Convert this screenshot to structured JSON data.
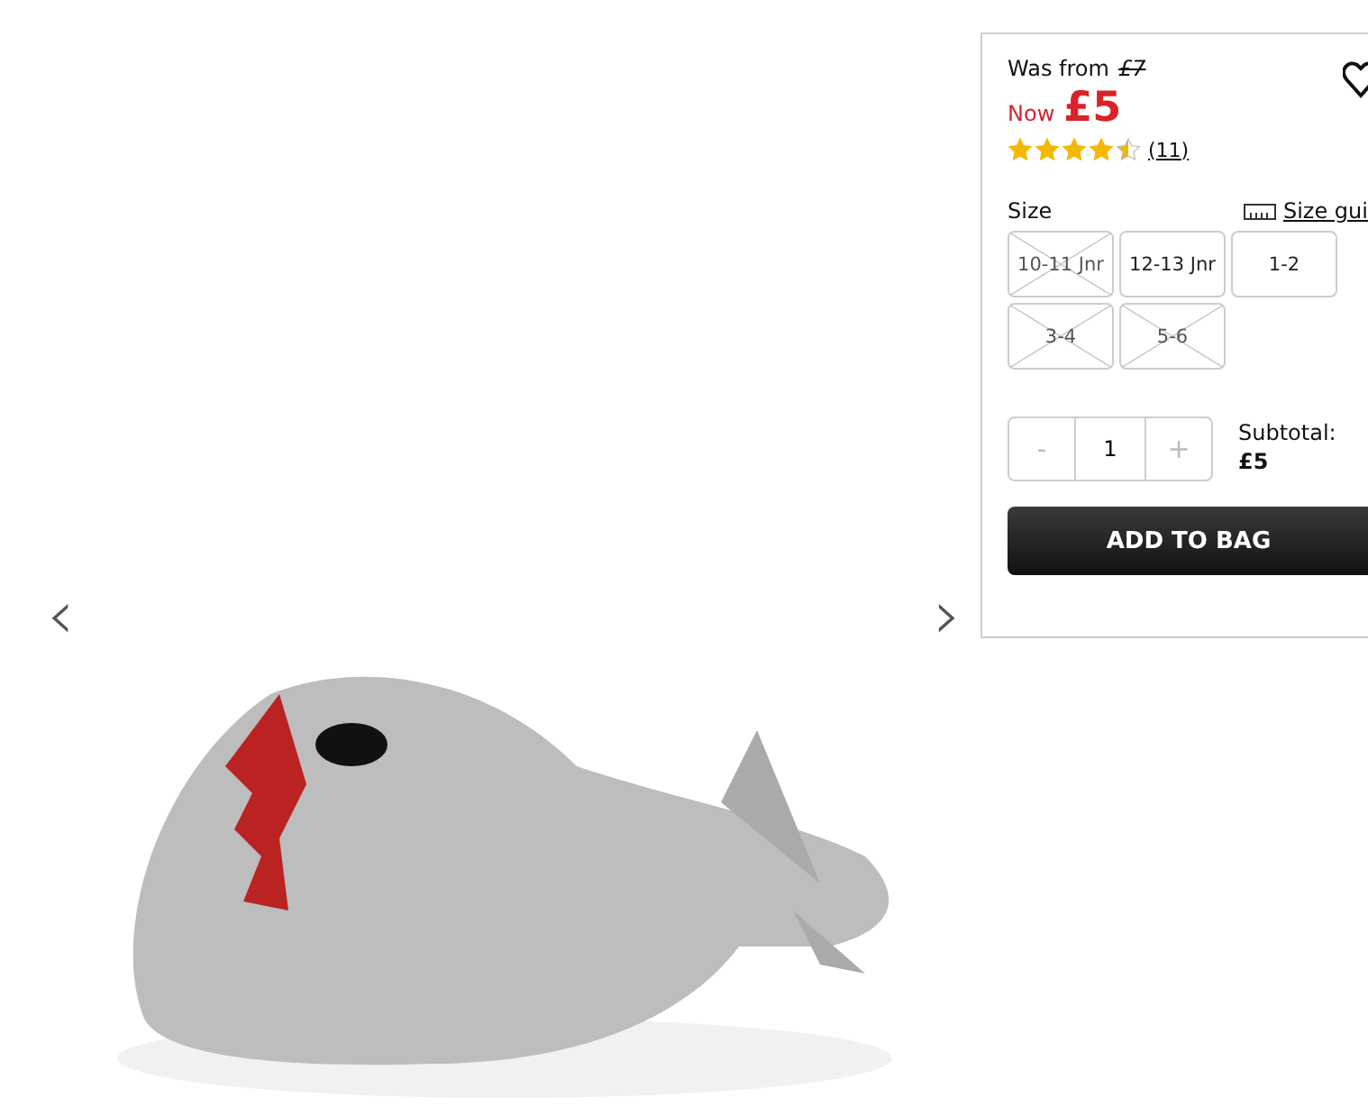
{
  "gallery": {
    "prev_label": "‹",
    "next_label": "›"
  },
  "price": {
    "was_label": "Was from",
    "was": "£7",
    "now_label": "Now",
    "now": "£5"
  },
  "rating": {
    "stars": 4.5,
    "count": "(11)"
  },
  "size": {
    "label": "Size",
    "guide": "Size gui",
    "options": [
      {
        "label": "10-11 Jnr",
        "available": false
      },
      {
        "label": "12-13 Jnr",
        "available": true
      },
      {
        "label": "1-2",
        "available": true
      },
      {
        "label": "3-4",
        "available": false
      },
      {
        "label": "5-6",
        "available": false
      }
    ]
  },
  "quantity": {
    "minus": "-",
    "value": "1",
    "plus": "+"
  },
  "subtotal": {
    "label": "Subtotal:",
    "value": "£5"
  },
  "add_button": "ADD TO BAG"
}
